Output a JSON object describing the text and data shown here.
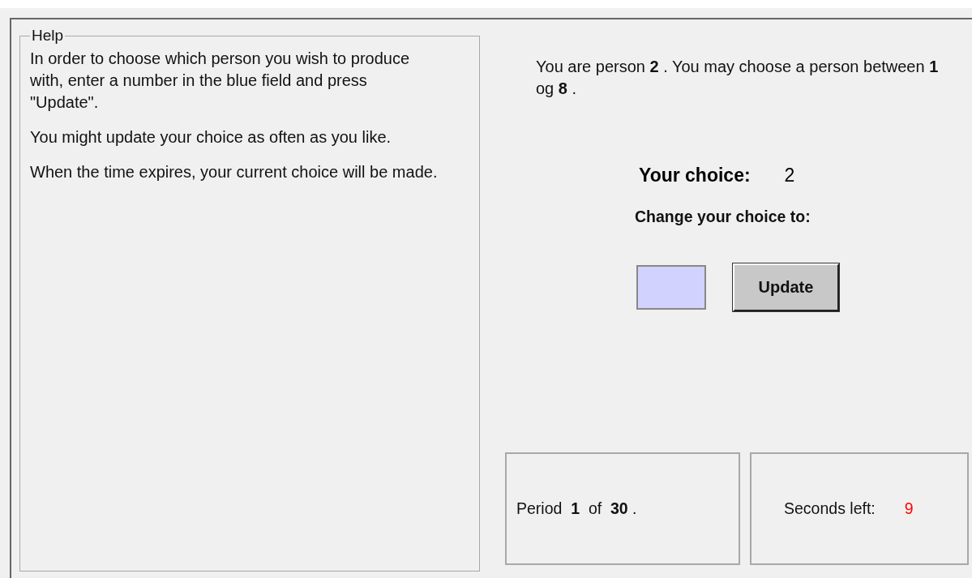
{
  "help": {
    "title": "Help",
    "paragraphs": [
      "In order to choose which person you wish to produce with, enter a number in the blue field and press \"Update\".",
      "You might update your choice as often as you like.",
      "When the time expires, your current choice will be made."
    ]
  },
  "intro": "You are person **2** . You may choose a person between **1** og **8** .",
  "choice": {
    "label": "Your choice:",
    "value": "2"
  },
  "change": {
    "label": "Change your choice to:",
    "input": {
      "color": "#d2d2ff"
    },
    "button": "Update"
  },
  "period": "Period  **1**  of  **30** .",
  "timer": {
    "label": "Seconds left:",
    "value": "9",
    "color": "#ff0000"
  }
}
